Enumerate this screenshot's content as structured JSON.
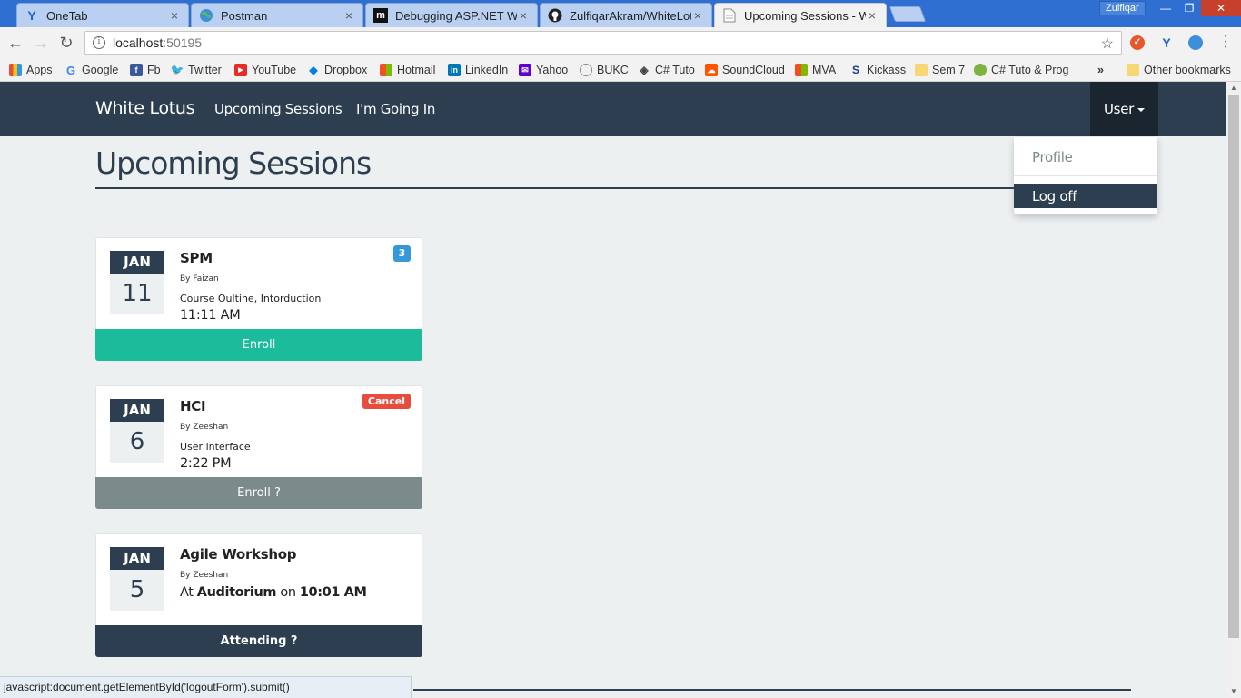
{
  "browser": {
    "tabs": [
      {
        "title": "OneTab",
        "icon": "onetab-icon",
        "active": false
      },
      {
        "title": "Postman",
        "icon": "globe-icon",
        "active": false
      },
      {
        "title": "Debugging ASP.NET Wel",
        "icon": "m-icon",
        "active": false
      },
      {
        "title": "ZulfiqarAkram/WhiteLotu",
        "icon": "github-icon",
        "active": false
      },
      {
        "title": "Upcoming Sessions - Wh",
        "icon": "page-icon",
        "active": true
      }
    ],
    "profile_name": "Zulfiqar",
    "address": {
      "host": "localhost",
      "port": ":50195"
    },
    "bookmarks": [
      "Apps",
      "Google",
      "Fb",
      "Twitter",
      "YouTube",
      "Dropbox",
      "Hotmail",
      "LinkedIn",
      "Yahoo",
      "BUKC",
      "C# Tuto",
      "SoundCloud",
      "MVA",
      "Kickass",
      "Sem 7",
      "C# Tuto & Prog"
    ],
    "overflow": "»",
    "other_bookmarks": "Other bookmarks",
    "status_url": "javascript:document.getElementById('logoutForm').submit()"
  },
  "navbar": {
    "brand": "White Lotus",
    "links": [
      "Upcoming Sessions",
      "I'm Going In"
    ],
    "user_label": "User"
  },
  "user_menu": {
    "profile": "Profile",
    "logoff": "Log off"
  },
  "page": {
    "title": "Upcoming Sessions"
  },
  "sessions": [
    {
      "month": "JAN",
      "day": "11",
      "title": "SPM",
      "by": "By Faizan",
      "desc": "Course Oultine, Intorduction",
      "time": "11:11 AM",
      "badge": "3",
      "button": "Enroll"
    },
    {
      "month": "JAN",
      "day": "6",
      "title": "HCI",
      "by": "By Zeeshan",
      "desc": "User interface",
      "time": "2:22 PM",
      "badge": "Cancel",
      "button": "Enroll ?"
    },
    {
      "month": "JAN",
      "day": "5",
      "title": "Agile Workshop",
      "by": "By Zeeshan",
      "at": "At",
      "place": "Auditorium",
      "on": "on",
      "time": "10:01 AM",
      "button": "Attending ?"
    }
  ],
  "colors": {
    "navbar": "#2c3e50",
    "enroll_green": "#1abc9c",
    "cancel_red": "#e74c3c",
    "badge_blue": "#3498db",
    "gray_button": "#7b8a8b",
    "page_bg": "#ecf0f1"
  }
}
